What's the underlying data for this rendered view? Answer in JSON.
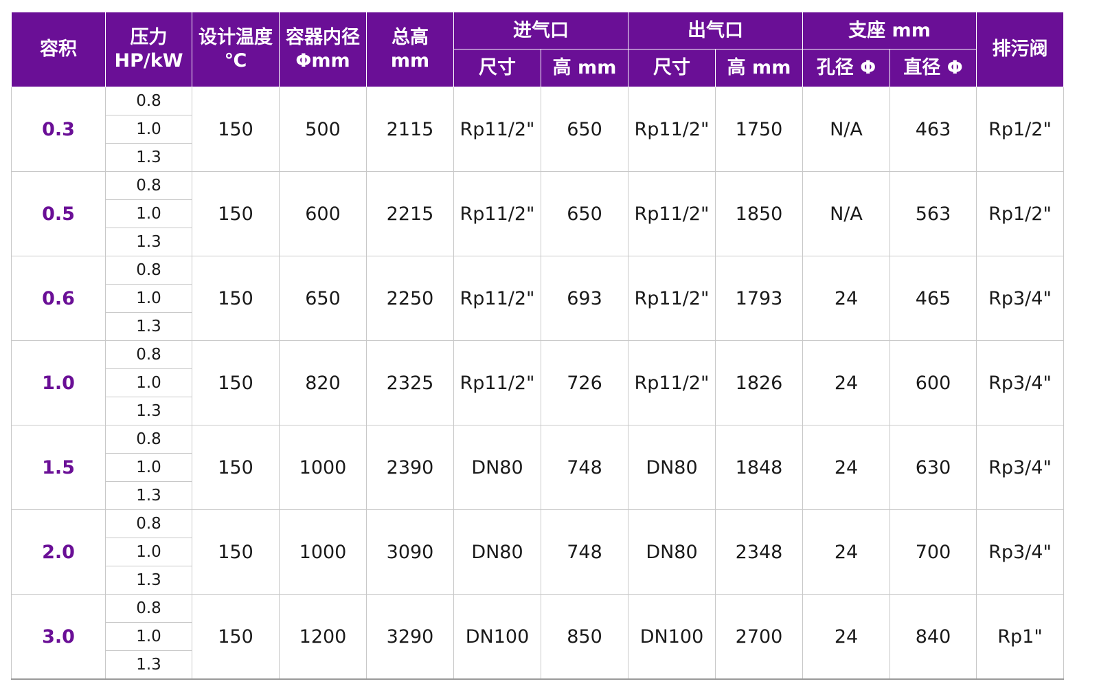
{
  "headers": {
    "volume": "容积",
    "pressure_line1": "压力",
    "pressure_line2": "HP/kW",
    "design_temp_line1": "设计温度",
    "design_temp_line2": "℃",
    "inner_dia_line1": "容器内径",
    "inner_dia_line2": "Φmm",
    "total_height_line1": "总高",
    "total_height_line2": "mm",
    "inlet": "进气口",
    "outlet": "出气口",
    "support": "支座 mm",
    "drain": "排污阀",
    "size": "尺寸",
    "height_mm": "高 mm",
    "hole_dia": "孔径 Φ",
    "diameter": "直径 Φ"
  },
  "rows": [
    {
      "volume": "0.3",
      "pressures": [
        "0.8",
        "1.0",
        "1.3"
      ],
      "design_temp": "150",
      "inner_dia": "500",
      "total_height": "2115",
      "inlet_size": "Rp11/2\"",
      "inlet_height": "650",
      "outlet_size": "Rp11/2\"",
      "outlet_height": "1750",
      "hole_dia": "N/A",
      "support_dia": "463",
      "drain": "Rp1/2\""
    },
    {
      "volume": "0.5",
      "pressures": [
        "0.8",
        "1.0",
        "1.3"
      ],
      "design_temp": "150",
      "inner_dia": "600",
      "total_height": "2215",
      "inlet_size": "Rp11/2\"",
      "inlet_height": "650",
      "outlet_size": "Rp11/2\"",
      "outlet_height": "1850",
      "hole_dia": "N/A",
      "support_dia": "563",
      "drain": "Rp1/2\""
    },
    {
      "volume": "0.6",
      "pressures": [
        "0.8",
        "1.0",
        "1.3"
      ],
      "design_temp": "150",
      "inner_dia": "650",
      "total_height": "2250",
      "inlet_size": "Rp11/2\"",
      "inlet_height": "693",
      "outlet_size": "Rp11/2\"",
      "outlet_height": "1793",
      "hole_dia": "24",
      "support_dia": "465",
      "drain": "Rp3/4\""
    },
    {
      "volume": "1.0",
      "pressures": [
        "0.8",
        "1.0",
        "1.3"
      ],
      "design_temp": "150",
      "inner_dia": "820",
      "total_height": "2325",
      "inlet_size": "Rp11/2\"",
      "inlet_height": "726",
      "outlet_size": "Rp11/2\"",
      "outlet_height": "1826",
      "hole_dia": "24",
      "support_dia": "600",
      "drain": "Rp3/4\""
    },
    {
      "volume": "1.5",
      "pressures": [
        "0.8",
        "1.0",
        "1.3"
      ],
      "design_temp": "150",
      "inner_dia": "1000",
      "total_height": "2390",
      "inlet_size": "DN80",
      "inlet_height": "748",
      "outlet_size": "DN80",
      "outlet_height": "1848",
      "hole_dia": "24",
      "support_dia": "630",
      "drain": "Rp3/4\""
    },
    {
      "volume": "2.0",
      "pressures": [
        "0.8",
        "1.0",
        "1.3"
      ],
      "design_temp": "150",
      "inner_dia": "1000",
      "total_height": "3090",
      "inlet_size": "DN80",
      "inlet_height": "748",
      "outlet_size": "DN80",
      "outlet_height": "2348",
      "hole_dia": "24",
      "support_dia": "700",
      "drain": "Rp3/4\""
    },
    {
      "volume": "3.0",
      "pressures": [
        "0.8",
        "1.0",
        "1.3"
      ],
      "design_temp": "150",
      "inner_dia": "1200",
      "total_height": "3290",
      "inlet_size": "DN100",
      "inlet_height": "850",
      "outlet_size": "DN100",
      "outlet_height": "2700",
      "hole_dia": "24",
      "support_dia": "840",
      "drain": "Rp1\""
    }
  ]
}
